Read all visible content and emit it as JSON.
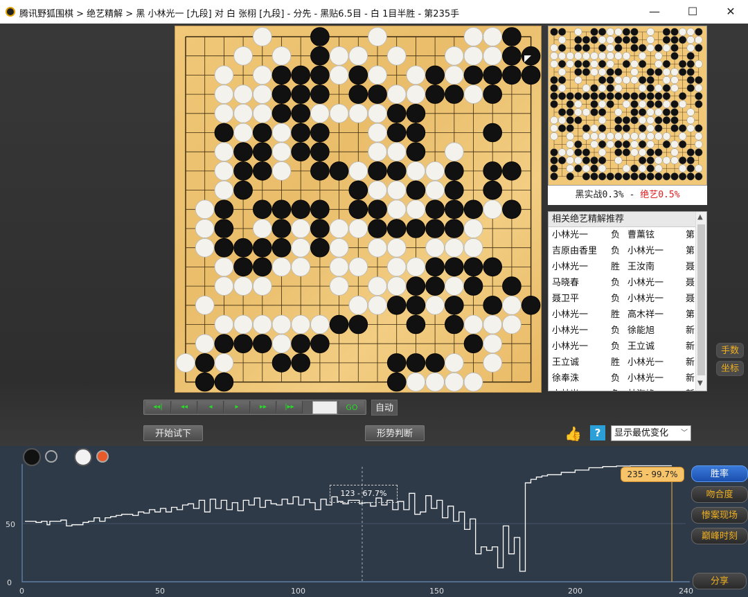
{
  "window": {
    "title": "腾讯野狐围棋 > 绝艺精解 > 黑 小林光一 [九段] 对 白 张栩 [九段] - 分先 - 黑贴6.5目 - 白 1目半胜 - 第235手",
    "minimize": "—",
    "maximize": "☐",
    "close": "✕"
  },
  "overview": {
    "black_label": "黑实战0.3%",
    "sep": " - ",
    "ai_label": "绝艺0.5%"
  },
  "related": {
    "header": "相关绝艺精解推荐",
    "rows": [
      {
        "p1": "小林光一",
        "res": "负",
        "p2": "曹薰铉",
        "tag": "第"
      },
      {
        "p1": "吉原由香里",
        "res": "负",
        "p2": "小林光一",
        "tag": "第"
      },
      {
        "p1": "小林光一",
        "res": "胜",
        "p2": "王汝南",
        "tag": "聂"
      },
      {
        "p1": "马晓春",
        "res": "负",
        "p2": "小林光一",
        "tag": "聂"
      },
      {
        "p1": "聂卫平",
        "res": "负",
        "p2": "小林光一",
        "tag": "聂"
      },
      {
        "p1": "小林光一",
        "res": "胜",
        "p2": "高木祥一",
        "tag": "第"
      },
      {
        "p1": "小林光一",
        "res": "负",
        "p2": "徐能旭",
        "tag": "新"
      },
      {
        "p1": "小林光一",
        "res": "负",
        "p2": "王立诚",
        "tag": "新"
      },
      {
        "p1": "王立诚",
        "res": "胜",
        "p2": "小林光一",
        "tag": "新"
      },
      {
        "p1": "徐奉洙",
        "res": "负",
        "p2": "小林光一",
        "tag": "新"
      },
      {
        "p1": "小林光一",
        "res": "负",
        "p2": "林海峰",
        "tag": "新"
      }
    ]
  },
  "side": {
    "moves": "手数",
    "coords": "坐标"
  },
  "nav": {
    "first": "◂◂|",
    "prev10": "◂◂",
    "prev": "◂",
    "next": "▸",
    "next10": "▸▸",
    "last": "|▸▸",
    "go": "GO",
    "auto": "自动"
  },
  "actions": {
    "try": "开始试下",
    "judge": "形势判断",
    "select": "显示最优变化"
  },
  "chart_tabs": {
    "winrate": "胜率",
    "match": "吻合度",
    "blunder": "惨案现场",
    "peak": "巅峰时刻",
    "share": "分享"
  },
  "chart_data": {
    "type": "line",
    "xlim": [
      0,
      240
    ],
    "ylim": [
      0,
      100
    ],
    "xticks": [
      "0",
      "50",
      "100",
      "150",
      "200",
      "240"
    ],
    "yticks": [
      "0",
      "50"
    ],
    "hover": "123 - 67.7%",
    "current": "235 - 99.7%",
    "current_move": 235,
    "hover_move": 123,
    "series": [
      {
        "x": [
          1,
          3,
          5,
          7,
          9,
          10,
          12,
          14,
          16,
          18,
          20,
          22,
          24,
          26,
          28,
          30,
          32,
          34,
          36,
          38,
          40,
          42,
          44,
          46,
          48,
          50,
          52,
          54,
          56,
          58,
          60,
          62,
          64,
          66,
          68,
          70,
          72,
          74,
          76,
          78,
          80,
          82,
          84,
          86,
          88,
          90,
          92,
          94,
          96,
          98,
          100,
          102,
          104,
          106,
          108,
          110,
          112,
          114,
          116,
          118,
          120,
          122,
          123,
          124,
          126,
          128,
          130,
          132,
          134,
          136,
          138,
          140,
          142,
          144,
          146,
          148,
          150,
          152,
          154,
          156,
          158,
          160,
          162,
          164,
          166,
          168,
          170,
          172,
          174,
          176,
          178,
          180,
          182,
          184,
          186,
          188,
          190,
          195,
          200,
          205,
          210,
          215,
          220,
          225,
          230,
          235
        ],
        "y": [
          52,
          52,
          51,
          52,
          49,
          52,
          52,
          53,
          48,
          49,
          49,
          51,
          52,
          55,
          52,
          55,
          56,
          57,
          58,
          58,
          57,
          60,
          59,
          62,
          60,
          63,
          60,
          64,
          62,
          66,
          67,
          63,
          70,
          60,
          71,
          63,
          70,
          62,
          68,
          61,
          70,
          66,
          72,
          64,
          70,
          67,
          66,
          71,
          67,
          73,
          66,
          71,
          68,
          62,
          71,
          66,
          73,
          69,
          67,
          70,
          70,
          67,
          67.7,
          68,
          65,
          72,
          66,
          70,
          62,
          69,
          62,
          76,
          58,
          60,
          74,
          63,
          70,
          55,
          65,
          52,
          60,
          45,
          54,
          24,
          30,
          27,
          30,
          12,
          48,
          24,
          38,
          9,
          85,
          88,
          90,
          91,
          92,
          94,
          96,
          98,
          99,
          99.5,
          99.7,
          99.7,
          99.7,
          99.7
        ]
      }
    ]
  },
  "colors": {
    "accent_blue": "#1b4fb0",
    "tab_text": "#f0b020",
    "line": "#ffffff",
    "current_marker": "#f7c46a"
  }
}
